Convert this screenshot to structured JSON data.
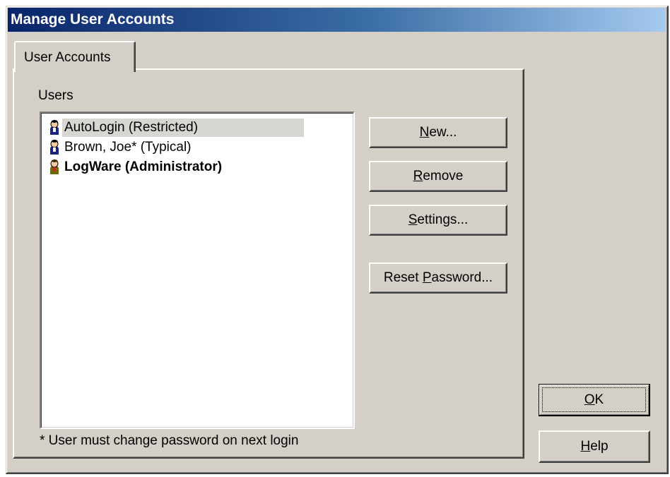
{
  "window": {
    "title": "Manage User Accounts"
  },
  "tabs": [
    {
      "label": "User Accounts",
      "active": true
    }
  ],
  "users_panel": {
    "label": "Users",
    "items": [
      {
        "name": "AutoLogin (Restricted)",
        "selected": true,
        "bold": false,
        "icon": "user-icon",
        "icon_color": "#1a237e"
      },
      {
        "name": "Brown, Joe* (Typical)",
        "selected": false,
        "bold": false,
        "icon": "user-icon",
        "icon_color": "#1a237e"
      },
      {
        "name": "LogWare (Administrator)",
        "selected": false,
        "bold": true,
        "icon": "admin-user-icon",
        "icon_color": "#6b6b00"
      }
    ],
    "footnote": "* User must change password on next login"
  },
  "buttons": {
    "new": {
      "pre": "",
      "accel": "N",
      "post": "ew..."
    },
    "remove": {
      "pre": "",
      "accel": "R",
      "post": "emove"
    },
    "settings": {
      "pre": "",
      "accel": "S",
      "post": "ettings..."
    },
    "reset_password": {
      "pre": "Reset ",
      "accel": "P",
      "post": "assword..."
    },
    "ok": {
      "pre": "",
      "accel": "O",
      "post": "K"
    },
    "help": {
      "pre": "",
      "accel": "H",
      "post": "elp"
    }
  },
  "colors": {
    "face": "#d4d0c8",
    "title_start": "#0a246a",
    "title_end": "#a6caf0",
    "selection": "#d8d6d0"
  }
}
